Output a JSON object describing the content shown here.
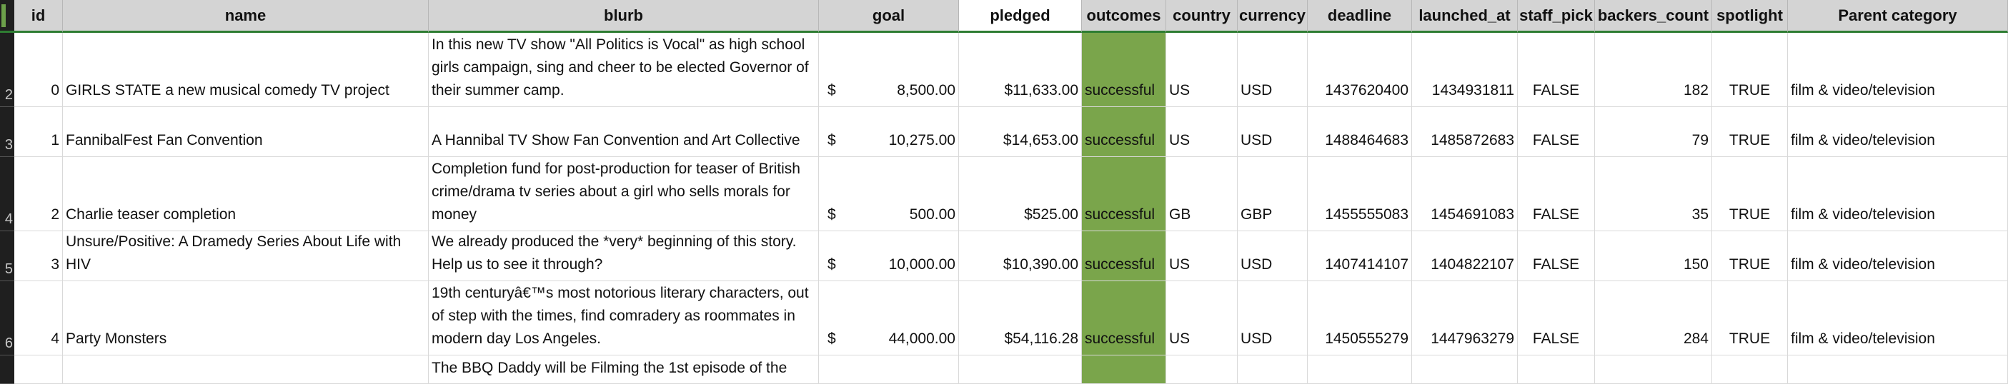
{
  "headers": [
    "id",
    "name",
    "blurb",
    "goal",
    "pledged",
    "outcomes",
    "country",
    "currency",
    "deadline",
    "launched_at",
    "staff_pick",
    "backers_count",
    "spotlight",
    "Parent category"
  ],
  "rows": [
    {
      "rownum": "2",
      "id": "0",
      "name": "GIRLS STATE a new musical comedy TV project",
      "blurb": "In this new TV show \"All Politics is Vocal\" as high school girls campaign, sing and cheer to be elected Governor of their summer camp.",
      "goal_cur": "$",
      "goal": "8,500.00",
      "pledged": "$11,633.00",
      "outcomes": "successful",
      "country": "US",
      "currency": "USD",
      "deadline": "1437620400",
      "launched_at": "1434931811",
      "staff_pick": "FALSE",
      "backers_count": "182",
      "spotlight": "TRUE",
      "parent": "film & video/television"
    },
    {
      "rownum": "3",
      "id": "1",
      "name": "FannibalFest Fan Convention",
      "blurb": "A Hannibal TV Show Fan Convention and Art Collective",
      "goal_cur": "$",
      "goal": "10,275.00",
      "pledged": "$14,653.00",
      "outcomes": "successful",
      "country": "US",
      "currency": "USD",
      "deadline": "1488464683",
      "launched_at": "1485872683",
      "staff_pick": "FALSE",
      "backers_count": "79",
      "spotlight": "TRUE",
      "parent": "film & video/television"
    },
    {
      "rownum": "4",
      "id": "2",
      "name": "Charlie teaser completion",
      "blurb": "Completion fund for post-production for teaser of British crime/drama tv series about a girl who sells morals for money",
      "goal_cur": "$",
      "goal": "500.00",
      "pledged": "$525.00",
      "outcomes": "successful",
      "country": "GB",
      "currency": "GBP",
      "deadline": "1455555083",
      "launched_at": "1454691083",
      "staff_pick": "FALSE",
      "backers_count": "35",
      "spotlight": "TRUE",
      "parent": "film & video/television"
    },
    {
      "rownum": "5",
      "id": "3",
      "name": "Unsure/Positive: A Dramedy Series About Life with HIV",
      "blurb": "We already produced the *very* beginning of this story. Help us to see it through?",
      "goal_cur": "$",
      "goal": "10,000.00",
      "pledged": "$10,390.00",
      "outcomes": "successful",
      "country": "US",
      "currency": "USD",
      "deadline": "1407414107",
      "launched_at": "1404822107",
      "staff_pick": "FALSE",
      "backers_count": "150",
      "spotlight": "TRUE",
      "parent": "film & video/television"
    },
    {
      "rownum": "6",
      "id": "4",
      "name": "Party Monsters",
      "blurb": "19th centuryâ€™s most notorious literary characters, out of step with the times, find comradery as roommates in modern day Los Angeles.",
      "goal_cur": "$",
      "goal": "44,000.00",
      "pledged": "$54,116.28",
      "outcomes": "successful",
      "country": "US",
      "currency": "USD",
      "deadline": "1450555279",
      "launched_at": "1447963279",
      "staff_pick": "FALSE",
      "backers_count": "284",
      "spotlight": "TRUE",
      "parent": "film & video/television"
    }
  ],
  "partial_row": {
    "blurb": "The BBQ Daddy will be Filming the 1st episode of the"
  },
  "colors": {
    "success": "#7aa54b",
    "header": "#d4d4d4",
    "rowheader": "#1f1f1f"
  }
}
